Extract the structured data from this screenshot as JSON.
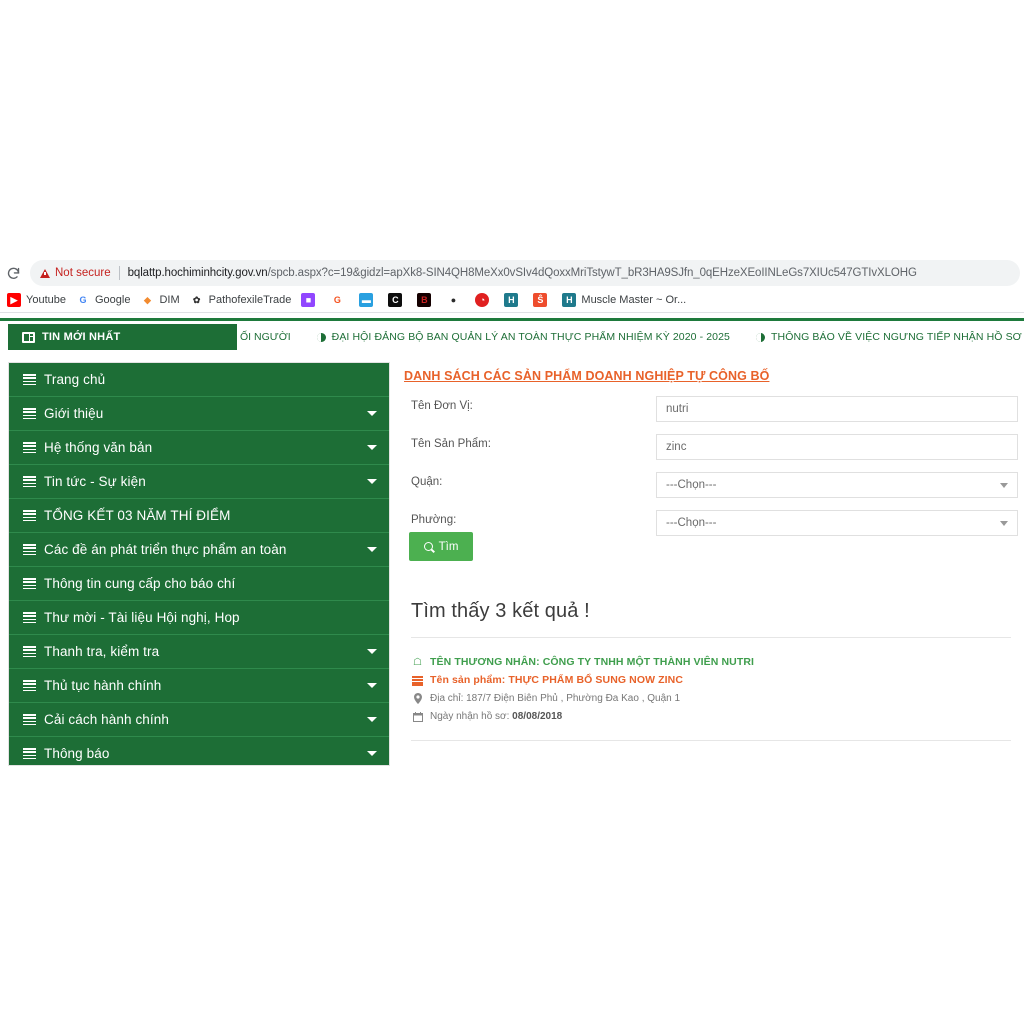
{
  "browser": {
    "reload_icon": "reload-icon",
    "security_label": "Not secure",
    "url_host": "bqlattp.hochiminhcity.gov.vn",
    "url_path": "/spcb.aspx?c=19&gidzl=apXk8-SIN4QH8MeXx0vSIv4dQoxxMriTstywT_bR3HA9SJfn_0qEHzeXEoIINLeGs7XIUc547GTIvXLOHG",
    "bookmarks": [
      {
        "label": "Youtube",
        "icon": "youtube-icon",
        "bg": "#ff0000",
        "fg": "#ffffff",
        "glyph": "▶",
        "round": false
      },
      {
        "label": "Google",
        "icon": "google-icon",
        "bg": "#ffffff",
        "fg": "#4285f4",
        "glyph": "G",
        "round": false
      },
      {
        "label": "DIM",
        "icon": "diamond-icon",
        "bg": "#ffffff",
        "fg": "#f28b30",
        "glyph": "◆",
        "round": false
      },
      {
        "label": "PathofexileTrade",
        "icon": "poe-icon",
        "bg": "#ffffff",
        "fg": "#333333",
        "glyph": "✿",
        "round": false
      },
      {
        "label": "",
        "icon": "twitch-icon",
        "bg": "#9146ff",
        "fg": "#ffffff",
        "glyph": "■",
        "round": false
      },
      {
        "label": "",
        "icon": "g-orange-icon",
        "bg": "#ffffff",
        "fg": "#f4511e",
        "glyph": "G",
        "round": false
      },
      {
        "label": "",
        "icon": "blue-app-icon",
        "bg": "#29a0e0",
        "fg": "#ffffff",
        "glyph": "▬",
        "round": false
      },
      {
        "label": "",
        "icon": "c-dark-icon",
        "bg": "#0d0d0d",
        "fg": "#ffffff",
        "glyph": "C",
        "round": false
      },
      {
        "label": "",
        "icon": "b-red-icon",
        "bg": "#140000",
        "fg": "#cc2222",
        "glyph": "B",
        "round": false
      },
      {
        "label": "",
        "icon": "globe-dark-icon",
        "bg": "#ffffff",
        "fg": "#2b2b2b",
        "glyph": "●",
        "round": true
      },
      {
        "label": "",
        "icon": "opera-red-icon",
        "bg": "#e02020",
        "fg": "#ffffff",
        "glyph": "◔",
        "round": true
      },
      {
        "label": "",
        "icon": "h-teal-icon",
        "bg": "#1f7a8c",
        "fg": "#ffffff",
        "glyph": "H",
        "round": false
      },
      {
        "label": "",
        "icon": "shopee-icon",
        "bg": "#ee4d2d",
        "fg": "#ffffff",
        "glyph": "Ŝ",
        "round": false
      },
      {
        "label": "Muscle Master ~ Or...",
        "icon": "h-teal2-icon",
        "bg": "#1f7a8c",
        "fg": "#ffffff",
        "glyph": "H",
        "round": false
      }
    ]
  },
  "newsbar": {
    "badge_label": "TIN MỚI NHẤT",
    "badge_icon": "newspaper-icon",
    "ticker_clip": "ỐI NGƯỜI",
    "items": [
      {
        "text": "ĐẠI HỘI ĐẢNG BỘ BAN QUẢN LÝ AN TOÀN THỰC PHẨM NHIỆM KỲ 2020 - 2025",
        "icon": "contrast-icon"
      },
      {
        "text": "THÔNG BÁO VỀ VIỆC NGƯNG TIẾP NHẬN HỒ SƠ CẤP GIẤY CH",
        "icon": "contrast-icon"
      }
    ]
  },
  "sidebar": {
    "items": [
      {
        "label": "Trang chủ",
        "caret": false
      },
      {
        "label": "Giới thiệu",
        "caret": true
      },
      {
        "label": "Hệ thống văn bản",
        "caret": true
      },
      {
        "label": "Tin tức - Sự kiện",
        "caret": true
      },
      {
        "label": "TỔNG KẾT 03 NĂM THÍ ĐIỂM",
        "caret": false
      },
      {
        "label": "Các đề án phát triển thực phẩm an toàn",
        "caret": true
      },
      {
        "label": "Thông tin cung cấp cho báo chí",
        "caret": false
      },
      {
        "label": "Thư mời - Tài liệu Hội nghị, Hop",
        "caret": false
      },
      {
        "label": "Thanh tra, kiểm tra",
        "caret": true
      },
      {
        "label": "Thủ tục hành chính",
        "caret": true
      },
      {
        "label": "Cải cách hành chính",
        "caret": true
      },
      {
        "label": "Thông báo",
        "caret": true
      }
    ]
  },
  "main": {
    "page_title": "DANH SÁCH CÁC SẢN PHẨM DOANH NGHIỆP TỰ CÔNG BỐ",
    "form": {
      "fields": [
        {
          "label": "Tên Đơn Vị:",
          "value": "nutri",
          "type": "text",
          "name": "ten-don-vi"
        },
        {
          "label": "Tên Sản Phẩm:",
          "value": "zinc",
          "type": "text",
          "name": "ten-san-pham"
        },
        {
          "label": "Quận:",
          "value": "---Chọn---",
          "type": "select",
          "name": "quan"
        },
        {
          "label": "Phường:",
          "value": "---Chọn---",
          "type": "select",
          "name": "phuong"
        }
      ],
      "search_button": "Tìm",
      "search_icon": "search-icon"
    },
    "results": {
      "heading": "Tìm thấy 3 kết quả !",
      "items": [
        {
          "merchant_label": "TÊN THƯƠNG NHÂN: CÔNG TY TNHH MỘT THÀNH VIÊN NUTRI",
          "merchant_icon": "home-icon",
          "product_label": "Tên sản phẩm: THỰC PHẨM BỔ SUNG NOW ZINC",
          "product_icon": "list-icon",
          "address_label": "Địa chỉ: 187/7 Điện Biên Phủ , Phường Đa Kao , Quận 1",
          "address_icon": "map-pin-icon",
          "date_prefix": "Ngày nhận hồ sơ: ",
          "date_value": "08/08/2018",
          "date_icon": "calendar-icon"
        }
      ]
    }
  },
  "colors": {
    "brand_green": "#1d6e36",
    "accent_orange": "#e8622a",
    "button_green": "#4cb050",
    "result_green": "#3f9e4d"
  }
}
